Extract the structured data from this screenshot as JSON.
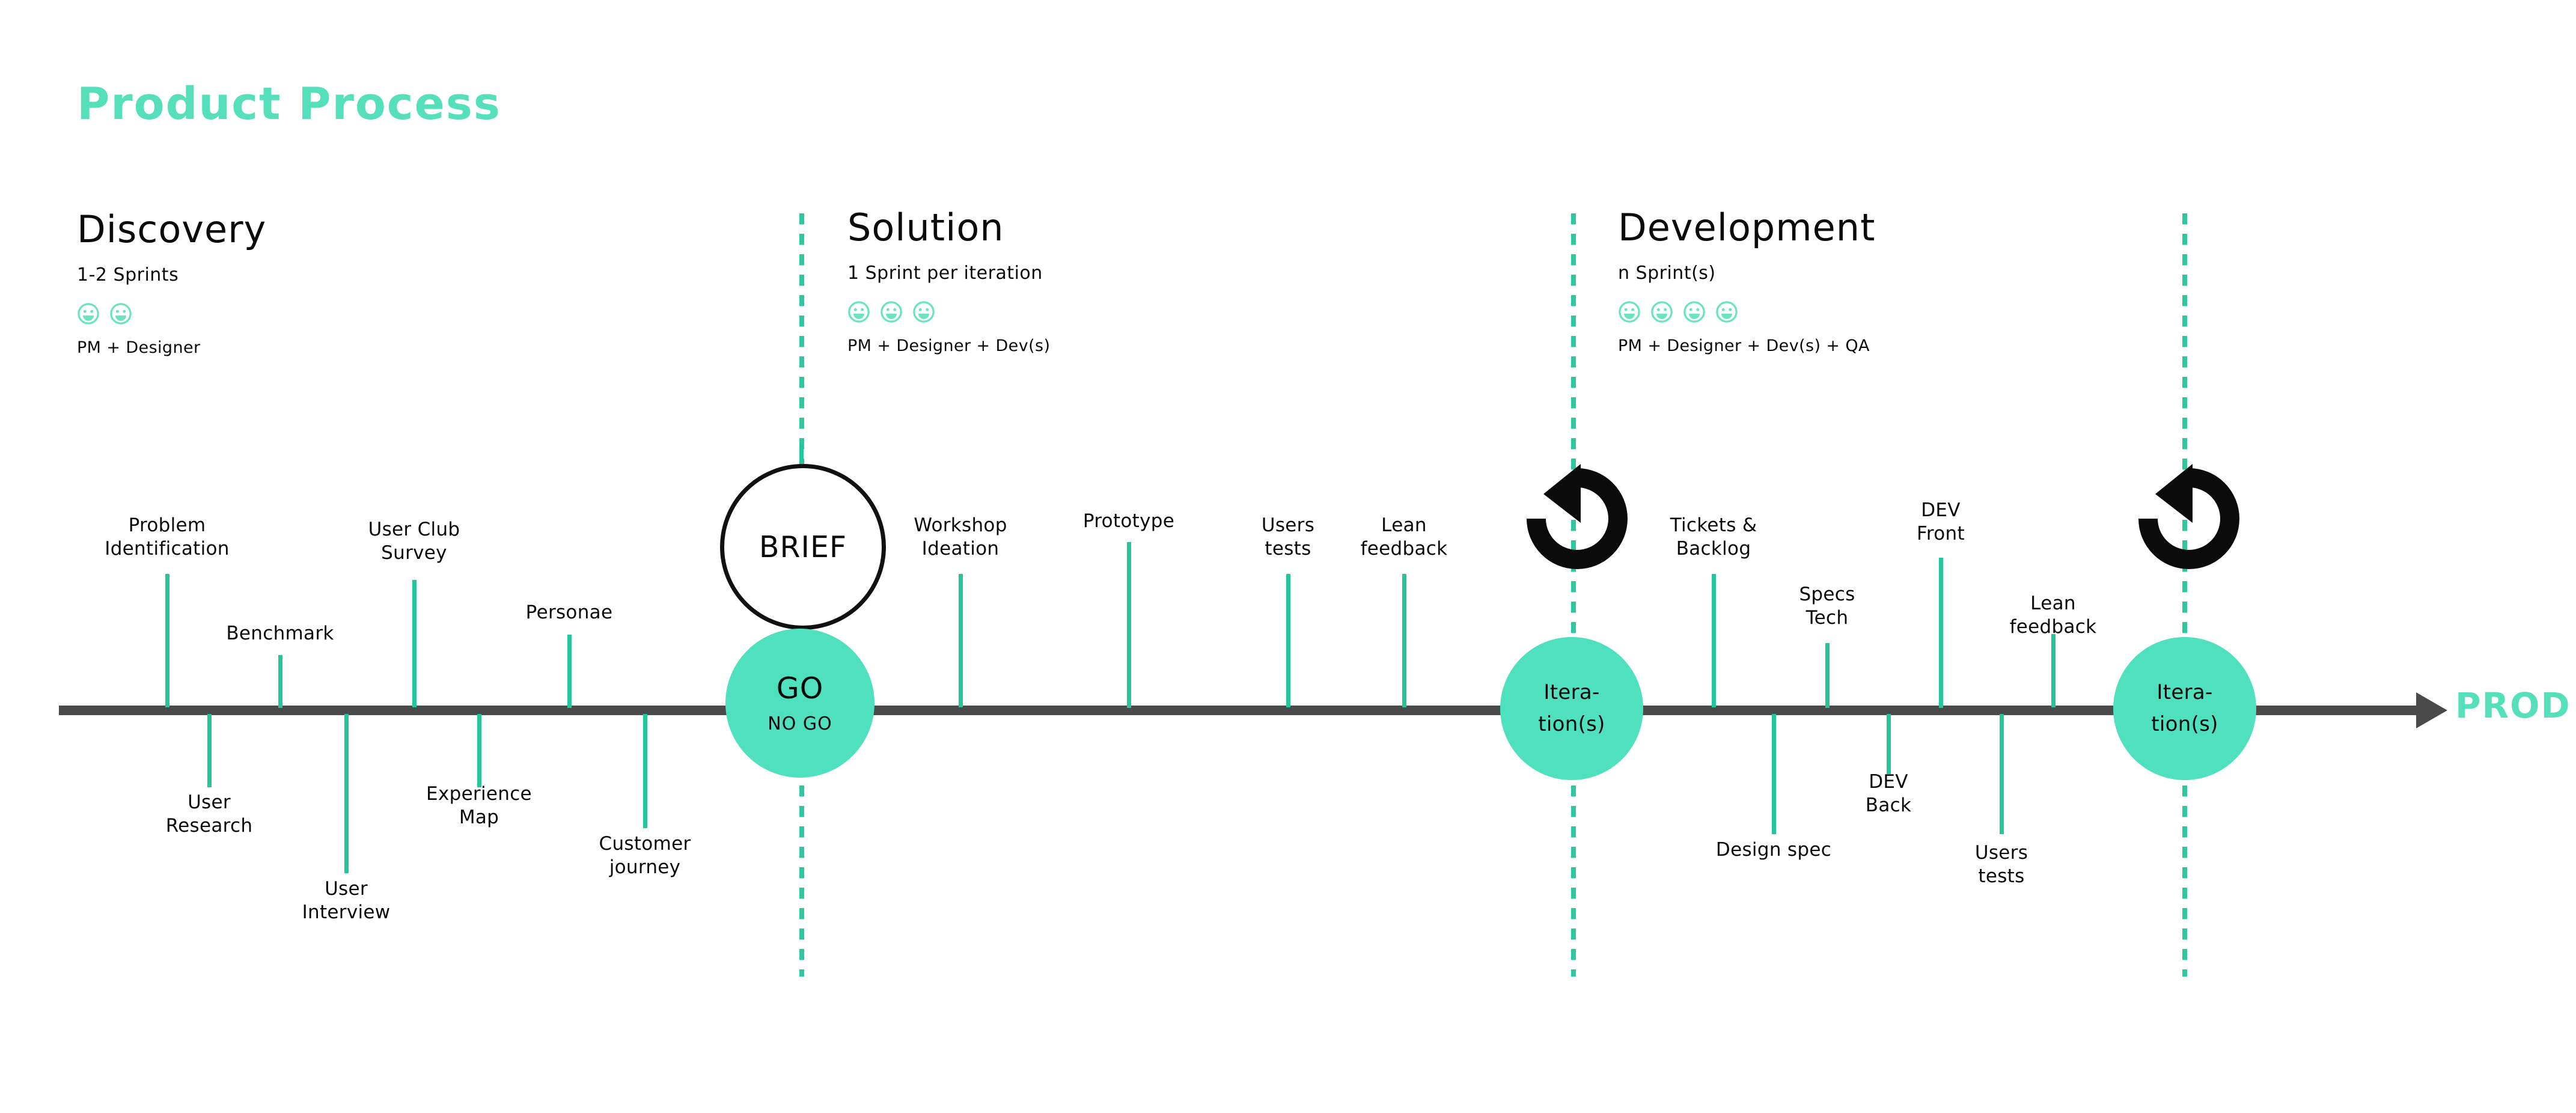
{
  "title": "Product Process",
  "colors": {
    "accent": "#55e0bb",
    "node_fill": "#4fe0bd",
    "tick": "#26c69c",
    "dash": "#2fc79e",
    "axis": "#4a4a4a",
    "ink": "#0b0b0b"
  },
  "phases": [
    {
      "name": "Discovery",
      "duration": "1-2 Sprints",
      "team_count": 2,
      "team": "PM + Designer"
    },
    {
      "name": "Solution",
      "duration": "1 Sprint per iteration",
      "team_count": 3,
      "team": "PM + Designer + Dev(s)"
    },
    {
      "name": "Development",
      "duration": "n Sprint(s)",
      "team_count": 4,
      "team": "PM + Designer + Dev(s) + QA"
    }
  ],
  "milestones": {
    "discovery": [
      {
        "label": "Problem\nIdentification",
        "side": "above"
      },
      {
        "label": "Benchmark",
        "side": "above"
      },
      {
        "label": "User Club\nSurvey",
        "side": "above"
      },
      {
        "label": "Personae",
        "side": "above"
      },
      {
        "label": "User\nResearch",
        "side": "below"
      },
      {
        "label": "User\nInterview",
        "side": "below"
      },
      {
        "label": "Experience\nMap",
        "side": "below"
      },
      {
        "label": "Customer\njourney",
        "side": "below"
      }
    ],
    "solution": [
      {
        "label": "Workshop\nIdeation",
        "side": "above"
      },
      {
        "label": "Prototype",
        "side": "above"
      },
      {
        "label": "Users\ntests",
        "side": "above"
      },
      {
        "label": "Lean\nfeedback",
        "side": "above"
      }
    ],
    "development": [
      {
        "label": "Tickets &\nBacklog",
        "side": "above"
      },
      {
        "label": "Specs\nTech",
        "side": "above"
      },
      {
        "label": "DEV\nFront",
        "side": "above"
      },
      {
        "label": "Lean\nfeedback",
        "side": "above"
      },
      {
        "label": "Design spec",
        "side": "below"
      },
      {
        "label": "DEV\nBack",
        "side": "below"
      },
      {
        "label": "Users\ntests",
        "side": "below"
      }
    ]
  },
  "nodes": {
    "brief": {
      "label": "BRIEF"
    },
    "go": {
      "main": "GO",
      "sub": "NO GO"
    },
    "iteration_1": {
      "line1": "Itera-",
      "line2": "tion(s)"
    },
    "iteration_2": {
      "line1": "Itera-",
      "line2": "tion(s)"
    }
  },
  "end_label": "PROD",
  "labels_flat": {
    "m0": "Problem",
    "m0b": "Identification",
    "m1": "Benchmark",
    "m2": "User Club",
    "m2b": "Survey",
    "m3": "Personae",
    "m4": "User",
    "m4b": "Research",
    "m5": "User",
    "m5b": "Interview",
    "m6": "Experience",
    "m6b": "Map",
    "m7": "Customer",
    "m7b": "journey",
    "m8": "Workshop",
    "m8b": "Ideation",
    "m9": "Prototype",
    "m10": "Users",
    "m10b": "tests",
    "m11": "Lean",
    "m11b": "feedback",
    "m12": "Tickets &",
    "m12b": "Backlog",
    "m13": "Specs",
    "m13b": "Tech",
    "m14": "DEV",
    "m14b": "Front",
    "m15": "Lean",
    "m15b": "feedback",
    "m16": "Design spec",
    "m17": "DEV",
    "m17b": "Back",
    "m18": "Users",
    "m18b": "tests"
  }
}
